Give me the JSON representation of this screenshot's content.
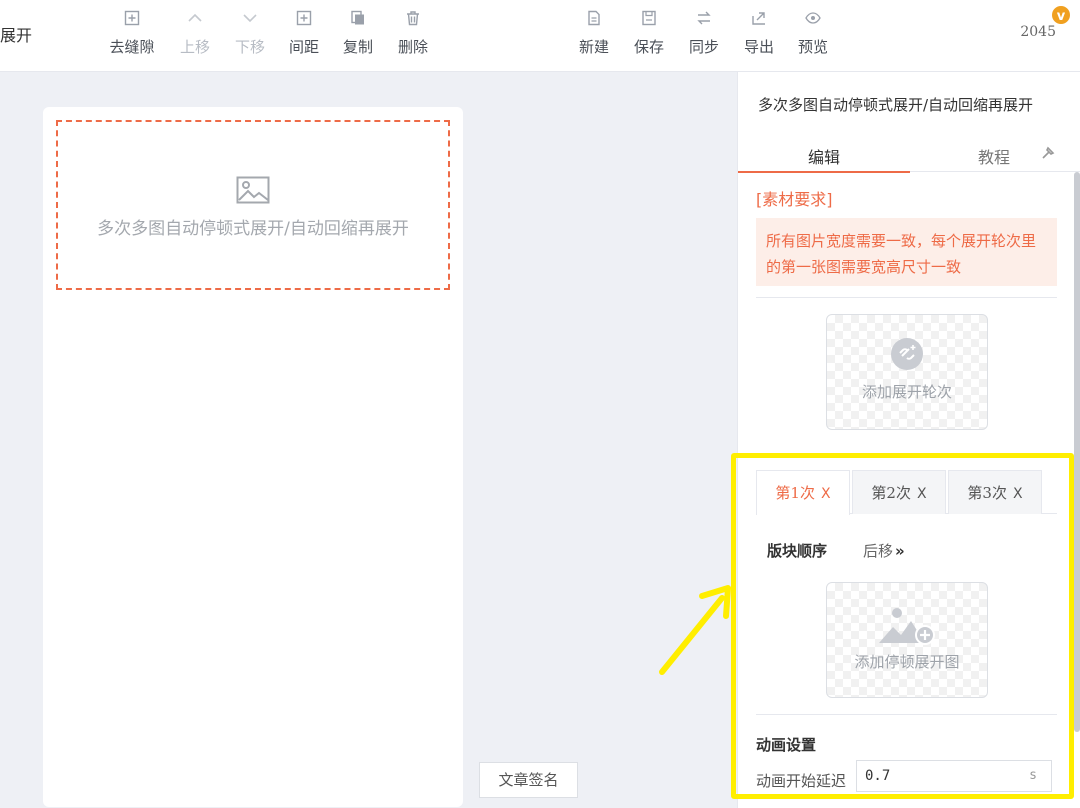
{
  "toolbar": {
    "cut_left_text": "展开",
    "buttons": [
      {
        "label": "去缝隙",
        "icon": "plus-square-icon",
        "disabled": false
      },
      {
        "label": "上移",
        "icon": "chevron-up-icon",
        "disabled": true
      },
      {
        "label": "下移",
        "icon": "chevron-down-icon",
        "disabled": true
      },
      {
        "label": "间距",
        "icon": "plus-square-icon",
        "disabled": false
      },
      {
        "label": "复制",
        "icon": "copy-icon",
        "disabled": false
      },
      {
        "label": "删除",
        "icon": "trash-icon",
        "disabled": false
      },
      {
        "label": "新建",
        "icon": "new-file-icon",
        "disabled": false
      },
      {
        "label": "保存",
        "icon": "save-icon",
        "disabled": false
      },
      {
        "label": "同步",
        "icon": "sync-icon",
        "disabled": false
      },
      {
        "label": "导出",
        "icon": "export-icon",
        "disabled": false
      },
      {
        "label": "预览",
        "icon": "eye-icon",
        "disabled": false
      }
    ],
    "counter": "2045",
    "badge": "v"
  },
  "canvas": {
    "placeholder_text": "多次多图自动停顿式展开/自动回缩再展开",
    "sign_button": "文章签名"
  },
  "panel": {
    "title": "多次多图自动停顿式展开/自动回缩再展开",
    "tabs": {
      "edit": "编辑",
      "tutorial": "教程"
    },
    "requirements_label": "[素材要求]",
    "requirements_text": "所有图片宽度需要一致，每个展开轮次里的第一张图需要宽高尺寸一致",
    "add_round": "添加展开轮次",
    "rounds": [
      {
        "label": "第1次",
        "close": "X",
        "active": true
      },
      {
        "label": "第2次",
        "close": "X",
        "active": false
      },
      {
        "label": "第3次",
        "close": "X",
        "active": false
      }
    ],
    "block_order_label": "版块顺序",
    "move_back": "后移",
    "move_back_chevron": "»",
    "add_pause_image": "添加停顿展开图",
    "animation_title": "动画设置",
    "delay_label": "动画开始延迟",
    "delay_value": "0.7",
    "delay_unit": "s"
  },
  "colors": {
    "accent": "#ee6b47",
    "highlight": "#ffee00",
    "badge": "#f0a020"
  }
}
